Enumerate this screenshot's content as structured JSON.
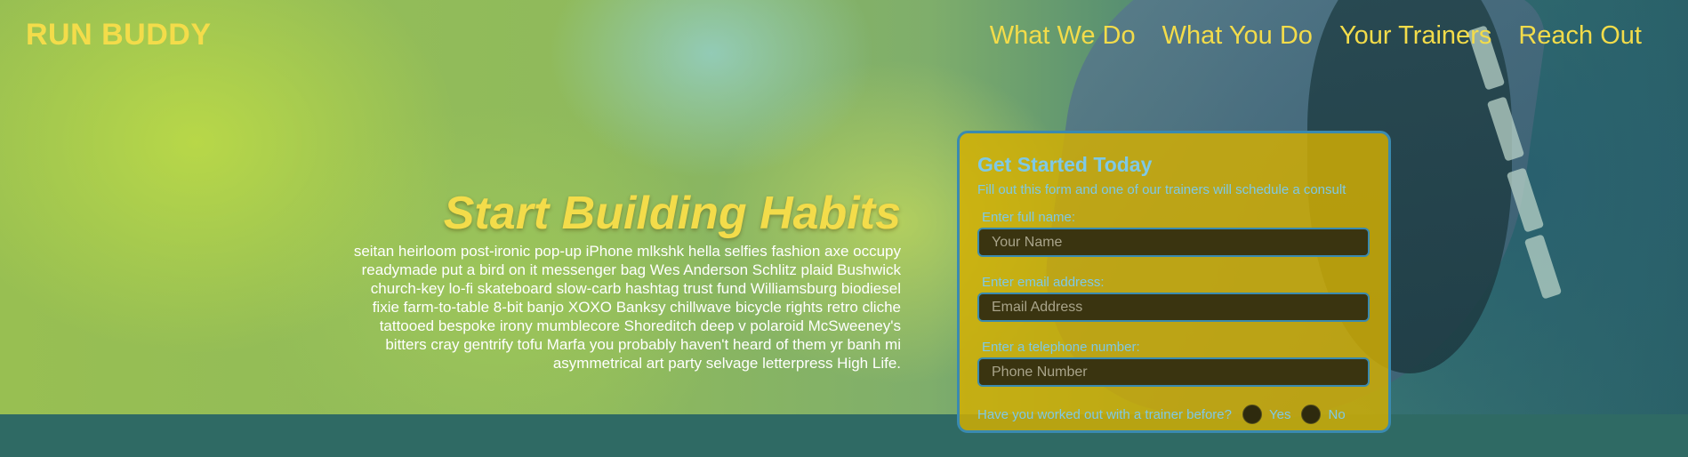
{
  "brand": {
    "name": "RUN BUDDY"
  },
  "nav": {
    "items": [
      {
        "label": "What We Do"
      },
      {
        "label": "What You Do"
      },
      {
        "label": "Your Trainers"
      },
      {
        "label": "Reach Out"
      }
    ]
  },
  "hero": {
    "title": "Start Building Habits",
    "body": "seitan heirloom post-ironic pop-up iPhone mlkshk hella selfies fashion axe occupy readymade put a bird on it messenger bag Wes Anderson Schlitz plaid Bushwick church-key lo-fi skateboard slow-carb hashtag trust fund Williamsburg biodiesel fixie farm-to-table 8-bit banjo XOXO Banksy chillwave bicycle rights retro cliche tattooed bespoke irony mumblecore Shoreditch deep v polaroid McSweeney's bitters cray gentrify tofu Marfa you probably haven't heard of them yr banh mi asymmetrical art party selvage letterpress High Life."
  },
  "form": {
    "title": "Get Started Today",
    "subtitle": "Fill out this form and one of our trainers will schedule a consult",
    "name_label": "Enter full name:",
    "name_placeholder": "Your Name",
    "email_label": "Enter email address:",
    "email_placeholder": "Email Address",
    "phone_label": "Enter a telephone number:",
    "phone_placeholder": "Phone Number",
    "trainer_question": "Have you worked out with a trainer before?",
    "yes_label": "Yes",
    "no_label": "No"
  },
  "colors": {
    "accent_yellow": "#f3dc4a",
    "form_bg": "#d6b000",
    "form_text": "#7ec9e6",
    "form_border": "#3a8ab0"
  }
}
